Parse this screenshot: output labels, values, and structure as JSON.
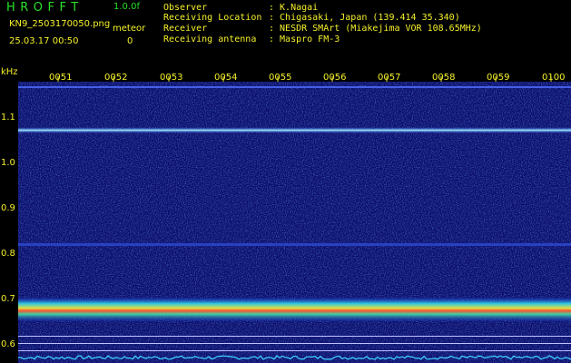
{
  "header": {
    "app_title": "HROFFT",
    "version": "1.0.0f",
    "filename": "KN9_2503170050.png",
    "timestamp": "25.03.17 00:50",
    "meteor_label": "meteor",
    "meteor_count": "0"
  },
  "info": [
    {
      "label": "Observer",
      "value": ": K.Nagai"
    },
    {
      "label": "Receiving Location",
      "value": ": Chigasaki, Japan (139.414 35.340)"
    },
    {
      "label": "Receiver",
      "value": ": NESDR SMArt (Miakejima VOR 108.65MHz)"
    },
    {
      "label": "Receiving antenna",
      "value": ": Maspro FM-3"
    }
  ],
  "axis": {
    "y_unit": "kHz",
    "y_ticks": [
      "1.1",
      "1.0",
      "0.9",
      "0.8",
      "0.7",
      "0.6"
    ],
    "x_ticks": [
      "0051",
      "0052",
      "0053",
      "0054",
      "0055",
      "0056",
      "0057",
      "0058",
      "0059",
      "0100"
    ]
  },
  "colors": {
    "background": "#0b0b6c",
    "label_green": "#28e028",
    "label_yellow": "#f4f02a",
    "signal_cyan": "#40d8ff",
    "signal_hot": "#ff4030"
  }
}
